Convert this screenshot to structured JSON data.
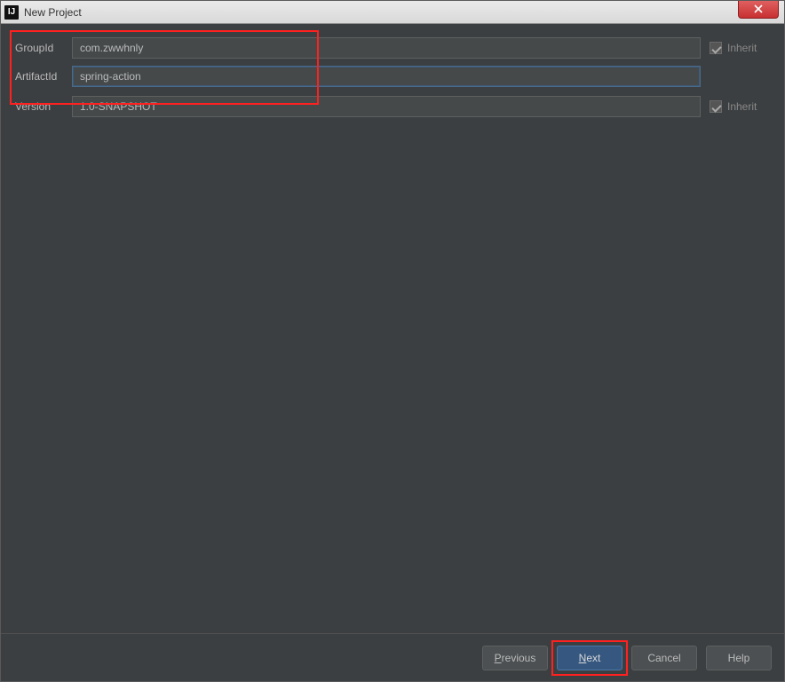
{
  "window": {
    "title": "New Project"
  },
  "form": {
    "groupId": {
      "label": "GroupId",
      "value": "com.zwwhnly",
      "inherit_label": "Inherit"
    },
    "artifactId": {
      "label": "ArtifactId",
      "value": "spring-action"
    },
    "version": {
      "label": "Version",
      "value": "1.0-SNAPSHOT",
      "inherit_label": "Inherit"
    }
  },
  "buttons": {
    "previous": {
      "mnemonic": "P",
      "rest": "revious"
    },
    "next": {
      "mnemonic": "N",
      "rest": "ext"
    },
    "cancel": {
      "label": "Cancel"
    },
    "help": {
      "label": "Help"
    }
  }
}
